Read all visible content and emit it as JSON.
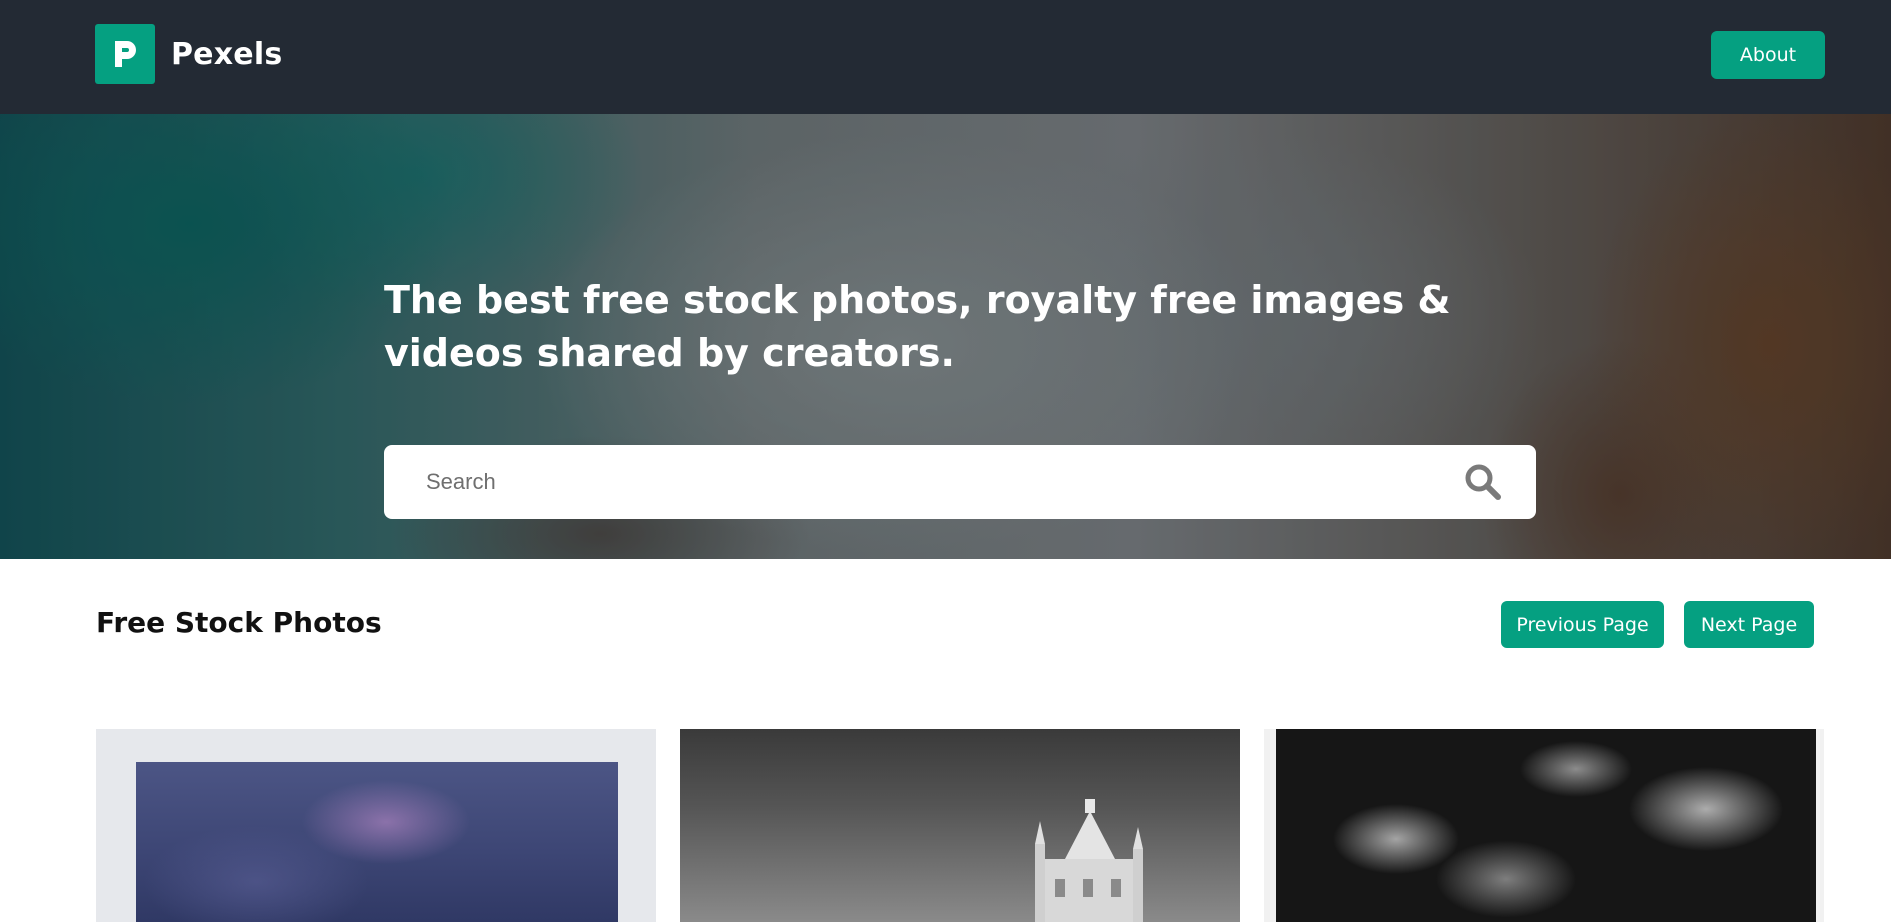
{
  "header": {
    "brand_name": "Pexels",
    "logo_icon": "pexels-logo-icon",
    "about_label": "About"
  },
  "hero": {
    "title": "The best free stock photos, royalty free images & videos shared by creators.",
    "search_placeholder": "Search",
    "search_icon": "search-icon"
  },
  "section": {
    "title": "Free Stock Photos",
    "prev_label": "Previous Page",
    "next_label": "Next Page"
  },
  "colors": {
    "header_bg": "#232a34",
    "accent": "#05a081",
    "page_bg": "#ffffff"
  }
}
